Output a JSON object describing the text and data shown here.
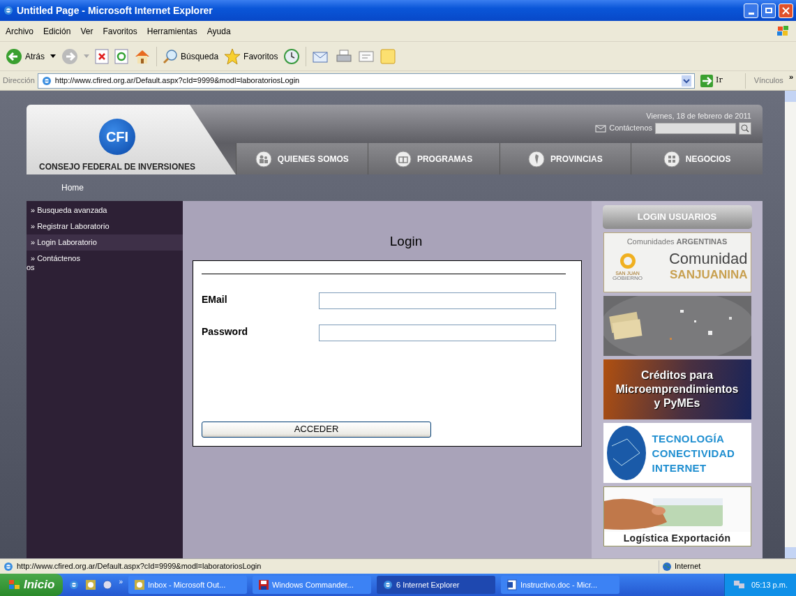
{
  "window": {
    "title": "Untitled Page - Microsoft Internet Explorer"
  },
  "menu": [
    "Archivo",
    "Edición",
    "Ver",
    "Favoritos",
    "Herramientas",
    "Ayuda"
  ],
  "toolbar": {
    "back": "Atrás",
    "search": "Búsqueda",
    "favorites": "Favoritos"
  },
  "address": {
    "label": "Dirección",
    "url": "http://www.cfired.org.ar/Default.aspx?cId=9999&modl=laboratoriosLogin",
    "go": "Ir",
    "links": "Vínculos",
    "more": "»"
  },
  "header": {
    "logo": "CFI",
    "org": "CONSEJO FEDERAL DE INVERSIONES",
    "date": "Viernes, 18 de febrero de 2011",
    "contact": "Contáctenos",
    "nav": [
      {
        "label": "QUIENES SOMOS",
        "kind": "people"
      },
      {
        "label": "PROGRAMAS",
        "kind": "book"
      },
      {
        "label": "PROVINCIAS",
        "kind": "map"
      },
      {
        "label": "NEGOCIOS",
        "kind": "grid"
      }
    ]
  },
  "breadcrumb": "Home",
  "sidebar": {
    "items": [
      {
        "label": "» Busqueda avanzada",
        "selected": false
      },
      {
        "label": "» Registrar Laboratorio",
        "selected": false
      },
      {
        "label": "» Login Laboratorio",
        "selected": true
      },
      {
        "label": "» Contáctenos",
        "selected": false
      }
    ],
    "stray": "os"
  },
  "login": {
    "title": "Login",
    "fields": [
      {
        "label": "EMail"
      },
      {
        "label": "Password"
      }
    ],
    "button": "ACCEDER"
  },
  "right_panel": {
    "header": "LOGIN USUARIOS",
    "banners": [
      {
        "kind": "comunidad",
        "caption": "Comunidades **ARGENTINAS**",
        "title": "Comunidad",
        "subtitle": "SANJUANINA",
        "logo": "SAN JUAN",
        "logo_sub": "GOBIERNO"
      },
      {
        "kind": "picture"
      },
      {
        "kind": "credit",
        "lines": [
          "Créditos para",
          "Microemprendimientos",
          "y PyMEs"
        ]
      },
      {
        "kind": "tech",
        "lines": [
          "TECNOLOGÍA",
          "CONECTIVIDAD",
          "INTERNET"
        ]
      },
      {
        "kind": "export",
        "caption": "Logística Exportación"
      }
    ]
  },
  "status_bar": {
    "url": "http://www.cfired.org.ar/Default.aspx?cId=9999&modl=laboratoriosLogin",
    "zone": "Internet"
  },
  "taskbar": {
    "start": "Inicio",
    "more": "»",
    "tasks": [
      {
        "label": "Inbox - Microsoft Out...",
        "kind": "outlook",
        "selected": false
      },
      {
        "label": "Windows Commander...",
        "kind": "disk",
        "selected": false
      },
      {
        "label": "6 Internet Explorer",
        "kind": "ie",
        "selected": true
      },
      {
        "label": "Instructivo.doc - Micr...",
        "kind": "word",
        "selected": false
      }
    ],
    "clock": "05:13 p.m."
  }
}
